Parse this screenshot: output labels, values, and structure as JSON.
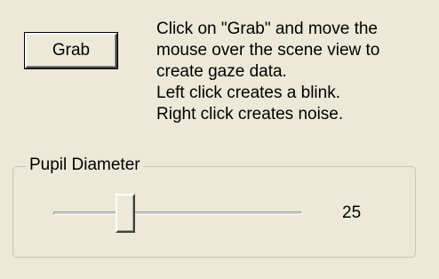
{
  "grab_button": {
    "label": "Grab"
  },
  "instructions": {
    "lines": [
      "Click on \"Grab\" and move the",
      "mouse over the scene view to",
      "create gaze data.",
      "Left click creates a blink.",
      "Right click creates noise."
    ]
  },
  "pupil_group": {
    "title": "Pupil Diameter",
    "slider": {
      "value": "25",
      "position_fraction": 0.27
    }
  }
}
